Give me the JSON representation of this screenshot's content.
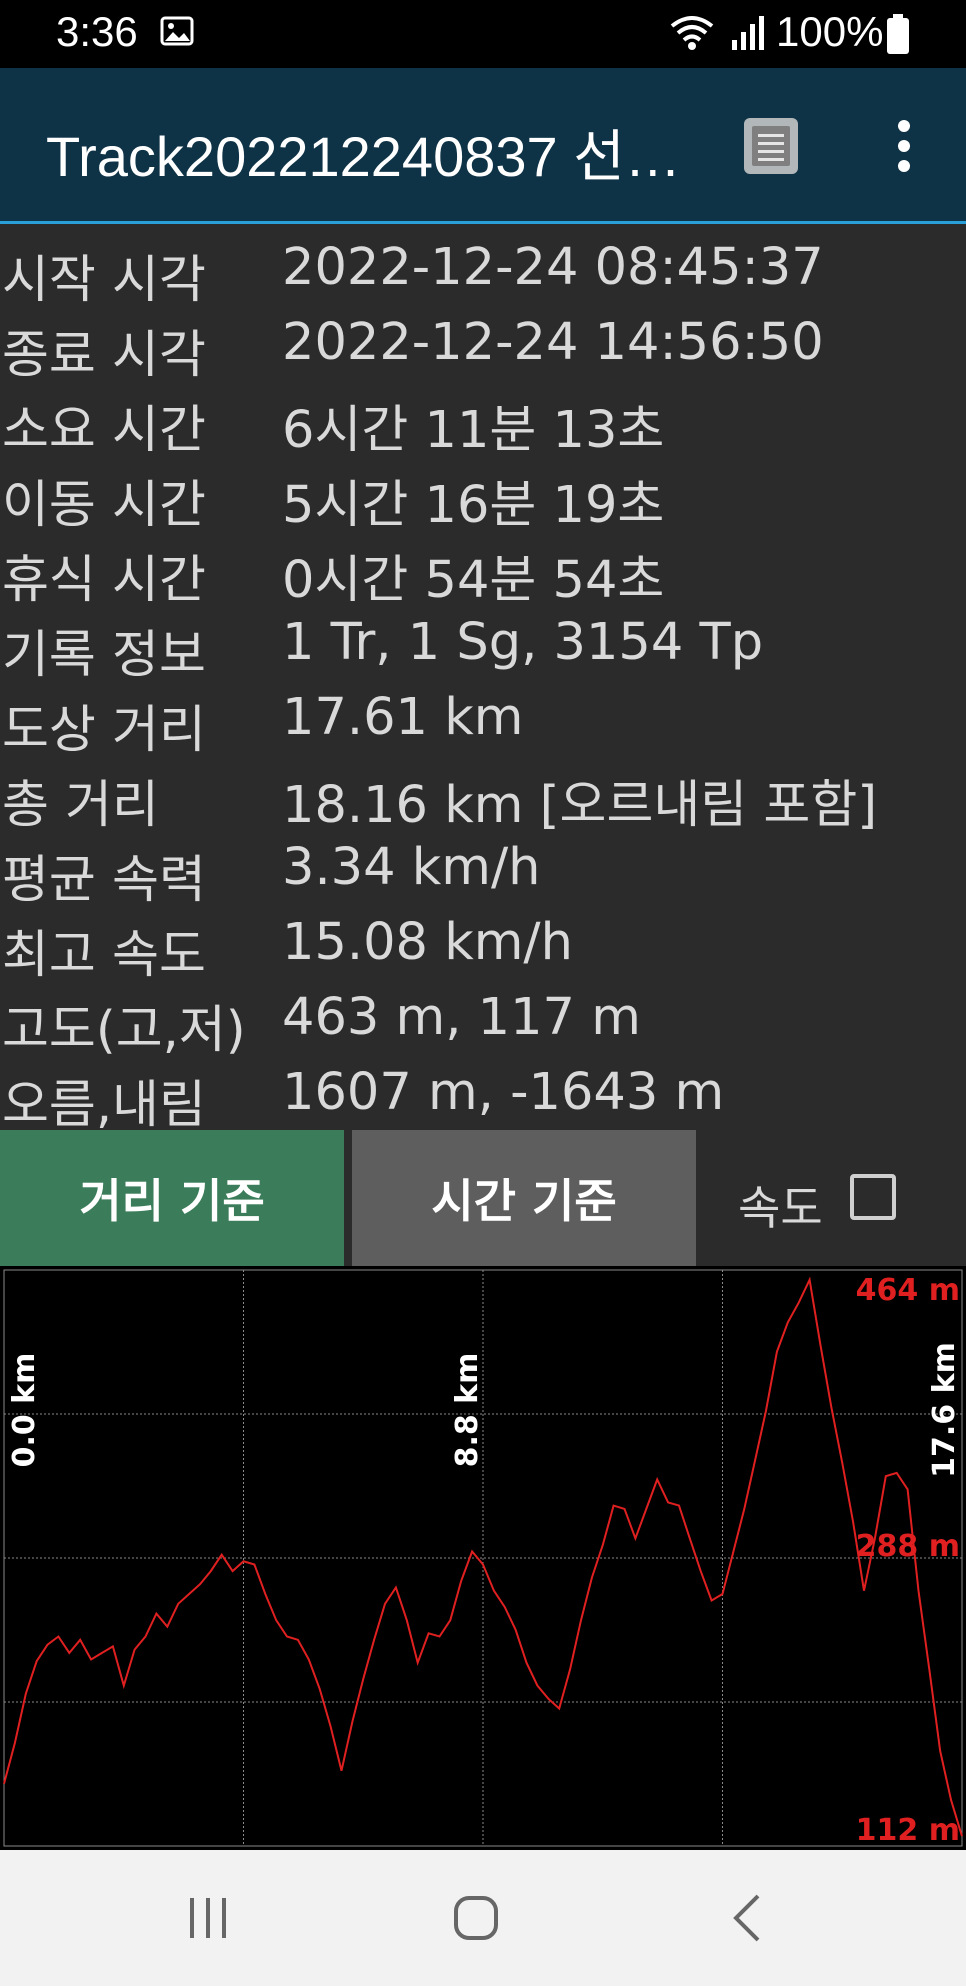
{
  "status_bar": {
    "time": "3:36",
    "battery": "100%",
    "icons": [
      "gallery-icon",
      "wifi-icon",
      "signal-icon",
      "battery-icon"
    ]
  },
  "app_bar": {
    "title": "Track202212240837 선…",
    "icons": [
      "list-icon",
      "more-vert-icon"
    ]
  },
  "stats": [
    {
      "label": "시작 시각",
      "value": "2022-12-24 08:45:37"
    },
    {
      "label": "종료 시각",
      "value": "2022-12-24 14:56:50"
    },
    {
      "label": "소요 시간",
      "value": "6시간 11분 13초"
    },
    {
      "label": "이동 시간",
      "value": "5시간 16분 19초"
    },
    {
      "label": "휴식 시간",
      "value": "0시간 54분 54초"
    },
    {
      "label": "기록 정보",
      "value": "1 Tr, 1 Sg, 3154 Tp"
    },
    {
      "label": "도상 거리",
      "value": "17.61 km"
    },
    {
      "label": "총 거리",
      "value": "18.16 km [오르내림 포함]"
    },
    {
      "label": "평균 속력",
      "value": "3.34 km/h"
    },
    {
      "label": "최고 속도",
      "value": "15.08 km/h"
    },
    {
      "label": "고도(고,저)",
      "value": "463 m, 117 m"
    },
    {
      "label": "오름,내림",
      "value": "1607 m, -1643 m"
    }
  ],
  "controls": {
    "distance_button": "거리 기준",
    "time_button": "시간 기준",
    "speed_label": "속도",
    "speed_checked": false,
    "active_mode": "distance"
  },
  "colors": {
    "line": "#e02020",
    "active_button": "#3b7d5a",
    "inactive_button": "#5e5e5e",
    "app_bar": "#0f3346"
  },
  "chart_data": {
    "type": "line",
    "x_unit": "km",
    "y_unit": "m",
    "xlim": [
      0,
      17.6
    ],
    "ylim": [
      112,
      464
    ],
    "x_tick_labels": [
      "0.0 km",
      "8.8 km",
      "17.6 km"
    ],
    "y_tick_labels": [
      "464 m",
      "288 m",
      "112 m"
    ],
    "grid": true,
    "series": [
      {
        "x": [
          0,
          0.2,
          0.4,
          0.6,
          0.8,
          1.0,
          1.2,
          1.4,
          1.6,
          1.8,
          2.0,
          2.2,
          2.4,
          2.6,
          2.8,
          3.0,
          3.2,
          3.4,
          3.6,
          3.8,
          4.0,
          4.2,
          4.4,
          4.6,
          4.8,
          5.0,
          5.2,
          5.4,
          5.6,
          5.8,
          6.0,
          6.2,
          6.4,
          6.6,
          6.8,
          7.0,
          7.2,
          7.4,
          7.6,
          7.8,
          8.0,
          8.2,
          8.4,
          8.6,
          8.8,
          9.0,
          9.2,
          9.4,
          9.6,
          9.8,
          10.0,
          10.2,
          10.4,
          10.6,
          10.8,
          11.0,
          11.2,
          11.4,
          11.6,
          11.8,
          12.0,
          12.2,
          12.4,
          12.6,
          12.8,
          13.0,
          13.2,
          13.4,
          13.6,
          13.8,
          14.0,
          14.2,
          14.4,
          14.6,
          14.8,
          15.0,
          15.2,
          15.4,
          15.6,
          15.8,
          16.0,
          16.2,
          16.4,
          16.6,
          16.8,
          17.0,
          17.2,
          17.4,
          17.6
        ],
        "y": [
          150,
          175,
          205,
          225,
          235,
          240,
          230,
          238,
          226,
          230,
          234,
          210,
          232,
          240,
          254,
          246,
          260,
          266,
          272,
          280,
          290,
          280,
          286,
          284,
          266,
          250,
          240,
          238,
          226,
          208,
          185,
          158,
          188,
          214,
          238,
          260,
          270,
          250,
          224,
          242,
          240,
          250,
          274,
          292,
          284,
          268,
          258,
          244,
          224,
          210,
          202,
          196,
          220,
          250,
          276,
          296,
          320,
          318,
          300,
          318,
          336,
          322,
          320,
          300,
          280,
          262,
          266,
          292,
          318,
          348,
          378,
          414,
          432,
          444,
          458,
          418,
          380,
          346,
          310,
          268,
          300,
          338,
          340,
          330,
          268,
          220,
          170,
          140,
          118
        ]
      }
    ]
  },
  "nav_bar": {
    "icons": [
      "recent-apps-icon",
      "home-icon",
      "back-icon"
    ]
  }
}
